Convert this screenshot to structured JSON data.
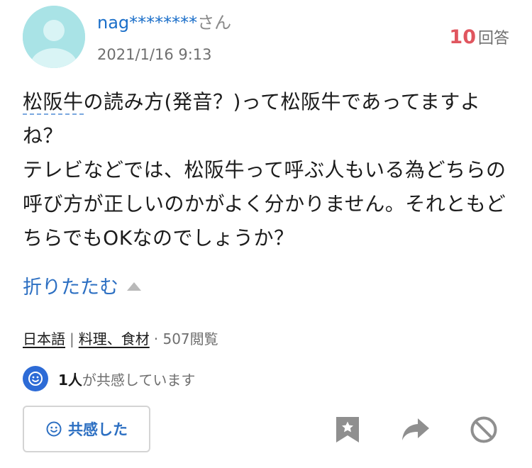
{
  "user": {
    "nickname": "nag********",
    "suffix": "さん",
    "date": "2021/1/16 9:13",
    "avatar_icon": "default-user-avatar"
  },
  "answers": {
    "count": "10",
    "label": "回答"
  },
  "question": {
    "keyword": "松阪牛",
    "line1_rest": "の読み方(発音？)って松阪牛であってますよね？",
    "line2": "テレビなどでは、松阪牛って呼ぶ人もいる為どちらの呼び方が正しいのかがよく分かりません。それともどちらでもOKなのでしょうか？"
  },
  "collapse": {
    "label": "折りたたむ",
    "icon": "triangle-up-icon"
  },
  "meta": {
    "category1": "日本語",
    "divider": "|",
    "category2": "料理、食材",
    "views": "· 507閲覧"
  },
  "empathy": {
    "count": "1人",
    "text": "が共感しています",
    "button_label": "共感した",
    "icon": "smile-icon"
  },
  "actions": {
    "bookmark_icon": "bookmark-star-icon",
    "share_icon": "share-arrow-icon",
    "block_icon": "prohibit-icon"
  },
  "colors": {
    "link_blue": "#2c6fc2",
    "answer_red": "#e0565f",
    "avatar_teal": "#a9e3e6",
    "empathy_blue": "#2d6bd6"
  }
}
